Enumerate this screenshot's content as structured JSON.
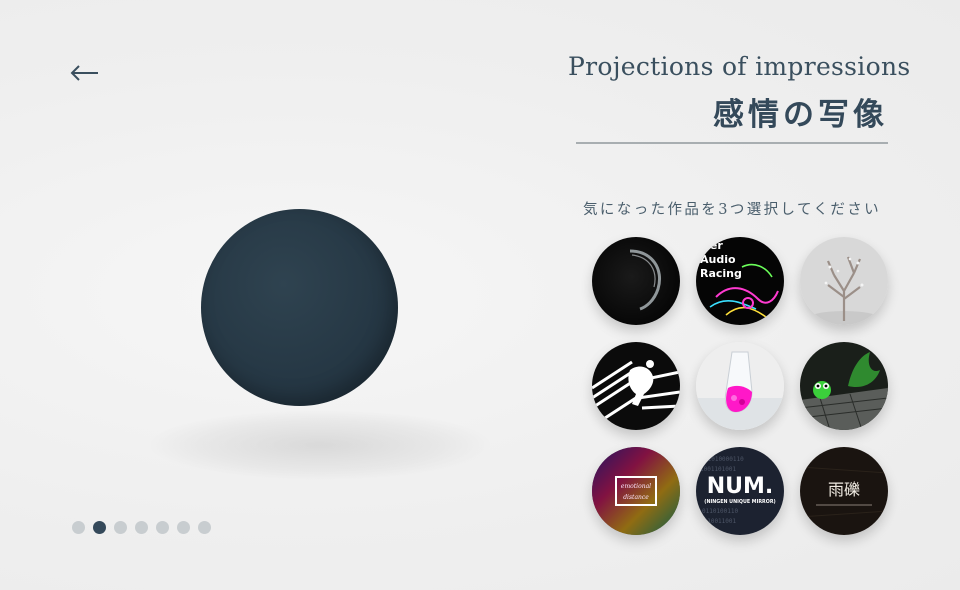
{
  "header": {
    "title_en": "Projections of impressions",
    "title_ja": "感情の写像"
  },
  "nav": {
    "back_icon": "arrow-left-icon"
  },
  "selection": {
    "prompt": "気になった作品を3つ選択してください",
    "required_count": 3,
    "works": [
      {
        "id": "work-1",
        "visual": "dark-ring"
      },
      {
        "id": "work-2",
        "visual": "hyper-audio-racing",
        "text": "per\nAudio\nRacing"
      },
      {
        "id": "work-3",
        "visual": "white-tree"
      },
      {
        "id": "work-4",
        "visual": "dancer-silhouette"
      },
      {
        "id": "work-5",
        "visual": "pink-bag"
      },
      {
        "id": "work-6",
        "visual": "green-creature"
      },
      {
        "id": "work-7",
        "visual": "emotional-distance",
        "text": "emotional distance"
      },
      {
        "id": "work-8",
        "visual": "num-binary",
        "text_main": "NUM.",
        "text_sub": "(NINGEN UNIQUE MIRROR)"
      },
      {
        "id": "work-9",
        "visual": "kanji-title",
        "text_main": "雨礫"
      }
    ]
  },
  "pager": {
    "total": 7,
    "current": 2
  },
  "colors": {
    "accent": "#34495a",
    "sphere": "#263845",
    "dot_inactive": "#c8cdd0"
  }
}
